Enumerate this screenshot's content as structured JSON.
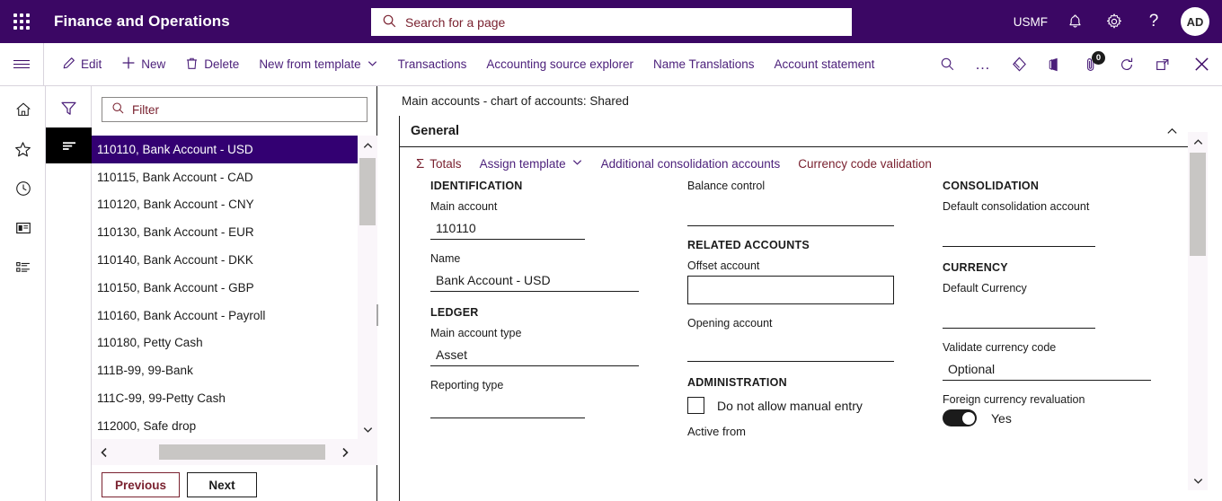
{
  "topbar": {
    "waffle_label": "App launcher",
    "app_title": "Finance and Operations",
    "search_placeholder": "Search for a page",
    "company": "USMF",
    "notifications_icon": "bell-icon",
    "settings_icon": "gear-icon",
    "help_icon": "question-mark-icon",
    "avatar_initials": "AD"
  },
  "action_pane": {
    "menu_icon": "hamburger-icon",
    "buttons": [
      {
        "label": "Edit",
        "icon": "pencil-icon"
      },
      {
        "label": "New",
        "icon": "plus-icon"
      },
      {
        "label": "Delete",
        "icon": "trash-icon"
      },
      {
        "label": "New from template",
        "icon": "chevron-down-icon"
      },
      {
        "label": "Transactions",
        "icon": ""
      },
      {
        "label": "Accounting source explorer",
        "icon": ""
      },
      {
        "label": "Name Translations",
        "icon": ""
      },
      {
        "label": "Account statement",
        "icon": ""
      }
    ],
    "right_icons": [
      {
        "name": "search-icon"
      },
      {
        "name": "overflow-ellipsis-icon"
      },
      {
        "name": "relationship-diamond-icon"
      },
      {
        "name": "office-app-icon"
      },
      {
        "name": "attachments-paperclip-icon",
        "badge": "0"
      },
      {
        "name": "refresh-icon"
      },
      {
        "name": "open-in-new-window-icon"
      },
      {
        "name": "close-icon"
      }
    ]
  },
  "rail": {
    "items": [
      {
        "name": "home-icon"
      },
      {
        "name": "favorites-star-icon"
      },
      {
        "name": "recent-clock-icon"
      },
      {
        "name": "workspaces-icon"
      },
      {
        "name": "modules-list-icon"
      }
    ]
  },
  "navcol": {
    "filter_icon": "funnel-filter-icon",
    "sort_icon": "sort-lines-icon"
  },
  "list_panel": {
    "filter_placeholder": "Filter",
    "filter_icon": "search-icon",
    "items": [
      {
        "label": "110110, Bank Account - USD",
        "selected": true
      },
      {
        "label": "110115, Bank Account - CAD",
        "selected": false
      },
      {
        "label": "110120, Bank Account - CNY",
        "selected": false
      },
      {
        "label": "110130, Bank Account - EUR",
        "selected": false
      },
      {
        "label": "110140, Bank Account - DKK",
        "selected": false
      },
      {
        "label": "110150, Bank Account - GBP",
        "selected": false
      },
      {
        "label": "110160, Bank Account - Payroll",
        "selected": false
      },
      {
        "label": "110180, Petty Cash",
        "selected": false
      },
      {
        "label": "111B-99, 99-Bank",
        "selected": false
      },
      {
        "label": "111C-99, 99-Petty Cash",
        "selected": false
      },
      {
        "label": "112000, Safe drop",
        "selected": false
      }
    ],
    "previous_label": "Previous",
    "next_label": "Next"
  },
  "content": {
    "breadcrumb": "Main accounts - chart of accounts: Shared",
    "fastcard_title": "General",
    "collapse_icon": "chevron-up-icon",
    "toolbar": [
      {
        "label": "Totals",
        "icon": "sigma-icon",
        "style": "red"
      },
      {
        "label": "Assign template",
        "icon": "chevron-down-icon",
        "style": "purple"
      },
      {
        "label": "Additional consolidation accounts",
        "icon": "",
        "style": "purple"
      },
      {
        "label": "Currency code validation",
        "icon": "",
        "style": "red"
      }
    ],
    "column1": {
      "section1_title": "IDENTIFICATION",
      "main_account_label": "Main account",
      "main_account_value": "110110",
      "name_label": "Name",
      "name_value": "Bank Account - USD",
      "section2_title": "LEDGER",
      "main_account_type_label": "Main account type",
      "main_account_type_value": "Asset",
      "reporting_type_label": "Reporting type",
      "reporting_type_value": ""
    },
    "column2": {
      "balance_control_label": "Balance control",
      "balance_control_value": "",
      "section_related_title": "RELATED ACCOUNTS",
      "offset_account_label": "Offset account",
      "offset_account_value": "",
      "opening_account_label": "Opening account",
      "opening_account_value": "",
      "section_admin_title": "ADMINISTRATION",
      "no_manual_entry_label": "Do not allow manual entry",
      "no_manual_entry_checked": false,
      "active_from_label": "Active from"
    },
    "column3": {
      "section_consolidation_title": "CONSOLIDATION",
      "default_consolidation_label": "Default consolidation account",
      "default_consolidation_value": "",
      "section_currency_title": "CURRENCY",
      "default_currency_label": "Default Currency",
      "default_currency_value": "",
      "validate_currency_label": "Validate currency code",
      "validate_currency_value": "Optional",
      "foreign_revaluation_label": "Foreign currency revaluation",
      "foreign_revaluation_value": "Yes"
    }
  },
  "colors": {
    "brand_purple": "#3b0764",
    "selection_purple": "#330072",
    "link_purple": "#4b1f7a",
    "link_red": "#7a2230",
    "scrollbar_thumb": "#c8c6c4"
  }
}
